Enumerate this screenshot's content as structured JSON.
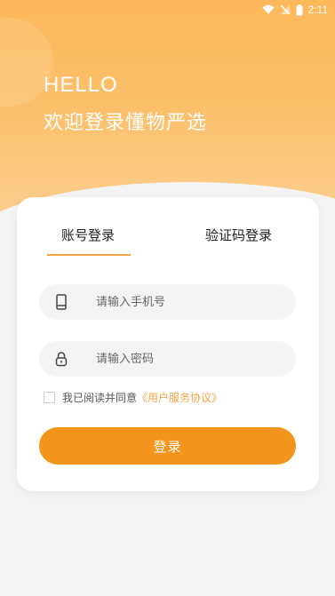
{
  "status_bar": {
    "time": "2:11",
    "icons": [
      "wifi-icon",
      "no-signal-icon",
      "battery-icon"
    ]
  },
  "header": {
    "greeting": "HELLO",
    "welcome": "欢迎登录懂物严选"
  },
  "tabs": [
    {
      "label": "账号登录",
      "active": true
    },
    {
      "label": "验证码登录",
      "active": false
    }
  ],
  "form": {
    "phone_placeholder": "请输入手机号",
    "phone_value": "",
    "password_placeholder": "请输入密码",
    "password_value": ""
  },
  "agreement": {
    "checked": false,
    "text": "我已阅读并同意",
    "link": "《用户服务协议》"
  },
  "login_button": "登录",
  "colors": {
    "accent": "#f3951c",
    "tab_underline": "#f2a446",
    "hero": "#fdb85a",
    "background": "#f4f4f4"
  }
}
